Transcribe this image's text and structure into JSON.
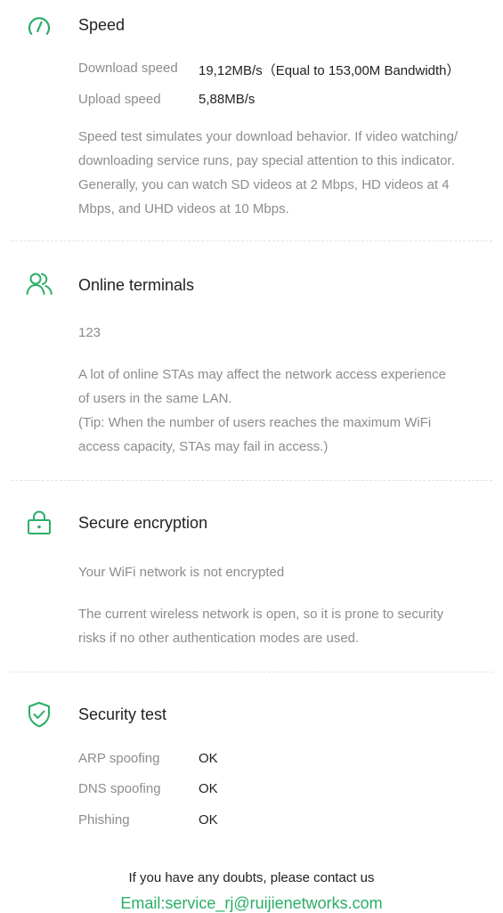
{
  "colors": {
    "accent": "#2aae67",
    "text_primary": "#222222",
    "text_secondary": "#8c8c8c",
    "divider": "#e3e3e3"
  },
  "speed": {
    "icon": "speedometer-icon",
    "title": "Speed",
    "download_label": "Download speed",
    "download_value": "19,12MB/s（Equal to 153,00M Bandwidth）",
    "upload_label": "Upload speed",
    "upload_value": "5,88MB/s",
    "description": [
      "Speed test simulates your download behavior. If video watching/",
      "downloading service runs, pay special attention to this indicator.",
      "Generally, you can watch SD videos at 2 Mbps, HD videos at 4",
      "Mbps, and UHD videos at 10 Mbps."
    ]
  },
  "terminals": {
    "icon": "users-icon",
    "title": "Online terminals",
    "count": "123",
    "description": [
      "A lot of online STAs may affect the network access experience",
      "of users in the same LAN.",
      "(Tip: When the number of users reaches the maximum WiFi",
      "access capacity, STAs may fail in access.)"
    ]
  },
  "encryption": {
    "icon": "lock-icon",
    "title": "Secure encryption",
    "status": "Your WiFi network is not encrypted",
    "description": [
      "The current wireless network is open, so it is prone to security",
      "risks if no other authentication modes are used."
    ]
  },
  "security": {
    "icon": "shield-check-icon",
    "title": "Security test",
    "items": [
      {
        "label": "ARP spoofing",
        "value": "OK"
      },
      {
        "label": "DNS spoofing",
        "value": "OK"
      },
      {
        "label": "Phishing",
        "value": "OK"
      }
    ]
  },
  "footer": {
    "doubt_text": "If you have any doubts, please contact us",
    "email": "Email:service_rj@ruijienetworks.com"
  }
}
